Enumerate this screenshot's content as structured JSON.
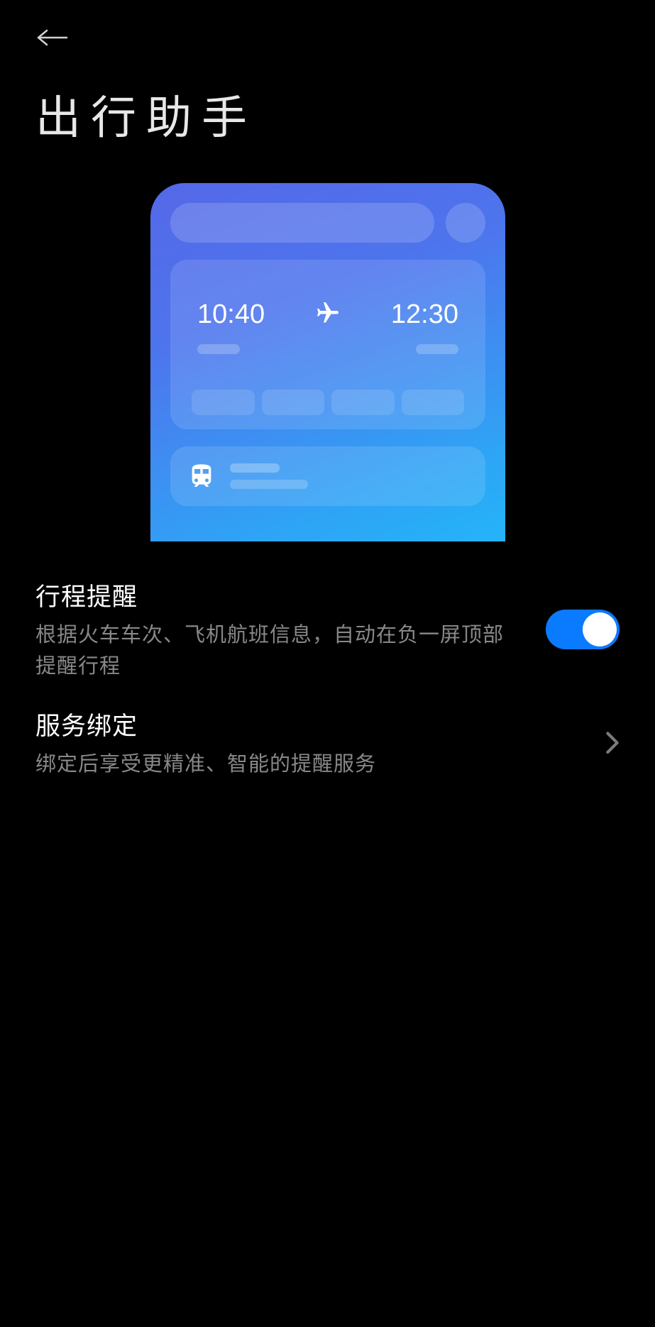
{
  "header": {
    "page_title": "出行助手"
  },
  "preview": {
    "departure_time": "10:40",
    "arrival_time": "12:30"
  },
  "settings": {
    "trip_reminder": {
      "title": "行程提醒",
      "description": "根据火车车次、飞机航班信息，自动在负一屏顶部提醒行程",
      "enabled": true
    },
    "service_binding": {
      "title": "服务绑定",
      "description": "绑定后享受更精准、智能的提醒服务"
    }
  },
  "icons": {
    "back": "back-arrow",
    "plane": "airplane",
    "train": "subway",
    "chevron": "chevron-right"
  }
}
